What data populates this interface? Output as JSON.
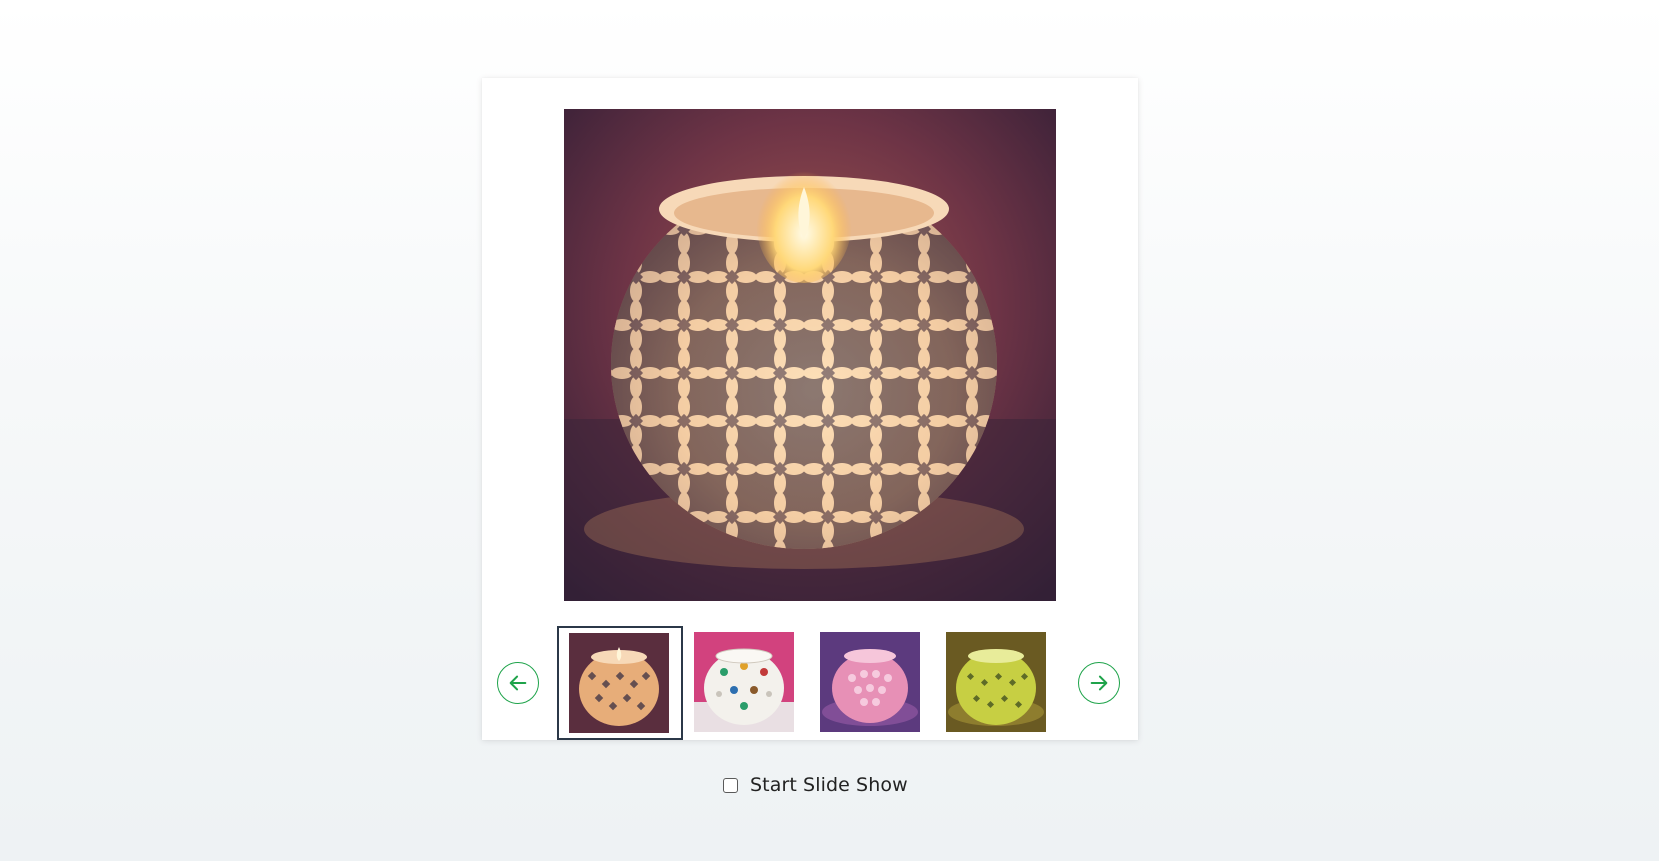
{
  "gallery": {
    "main_image": {
      "icon": "mosaic-candle-holder-photo",
      "alt": ""
    },
    "prev_button": {
      "icon": "arrow-left-icon"
    },
    "next_button": {
      "icon": "arrow-right-icon"
    },
    "selected_index": 0,
    "thumbnails": [
      {
        "icon": "mosaic-candle-amber-thumbnail",
        "selected": true
      },
      {
        "icon": "mosaic-candle-white-thumbnail",
        "selected": false
      },
      {
        "icon": "mosaic-candle-pink-thumbnail",
        "selected": false
      },
      {
        "icon": "mosaic-candle-green-thumbnail",
        "selected": false
      }
    ]
  },
  "slideshow": {
    "label": "Start Slide Show",
    "checked": false
  },
  "colors": {
    "accent": "#1ea34a",
    "selected_border": "#2b3848"
  }
}
